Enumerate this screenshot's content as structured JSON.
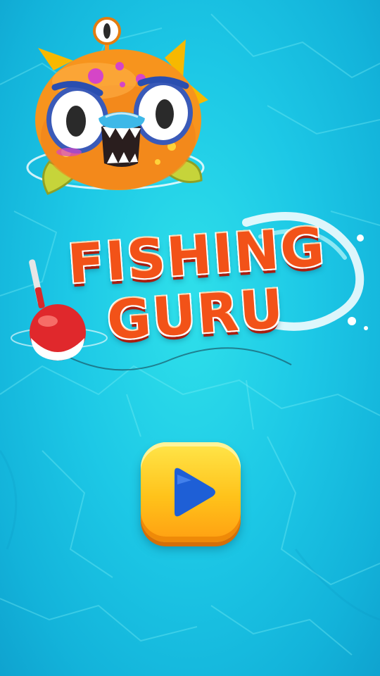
{
  "game": {
    "title_line_1": "FISHING",
    "title_line_2": "GURU"
  },
  "play_button": {
    "icon": "play-icon"
  },
  "colors": {
    "water": "#1dc8e6",
    "title": "#f25218",
    "play_button": "#ffc21a",
    "play_icon": "#1e5fd6",
    "pufferfish": "#f7941d",
    "bobber_red": "#e0282c"
  }
}
